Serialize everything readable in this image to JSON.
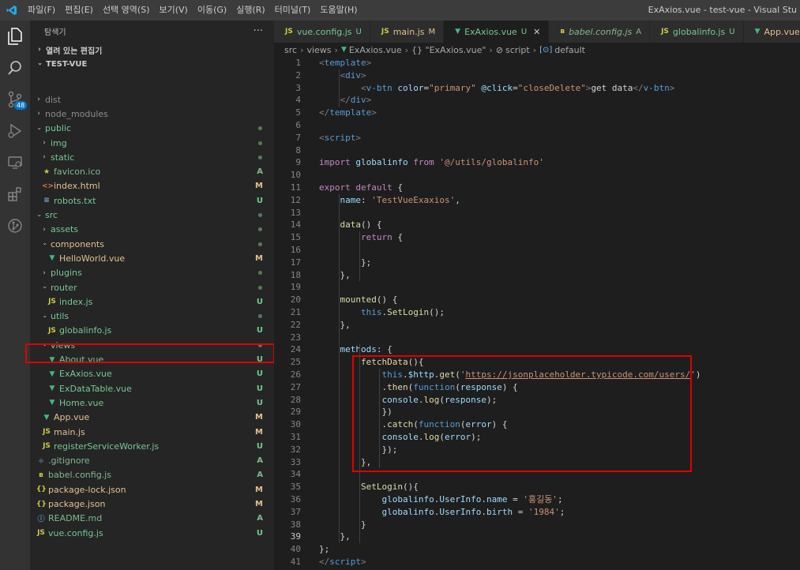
{
  "app": {
    "menu": [
      "파일(F)",
      "편집(E)",
      "선택 영역(S)",
      "보기(V)",
      "이동(G)",
      "실행(R)",
      "터미널(T)",
      "도움말(H)"
    ],
    "window_title": "ExAxios.vue - test-vue - Visual Stu"
  },
  "activity": {
    "scm_badge": "48"
  },
  "explorer": {
    "header": "탐색기",
    "more": "···",
    "open_editors": "열려 있는 편집기",
    "project": "TEST-VUE",
    "items": [
      {
        "label": "dist",
        "depth": 1,
        "kind": "folder",
        "status": "",
        "color": "#8c8c8c"
      },
      {
        "label": "node_modules",
        "depth": 1,
        "kind": "folder",
        "status": "",
        "color": "#8c8c8c"
      },
      {
        "label": "public",
        "depth": 1,
        "kind": "folder-open",
        "status": "dot",
        "color": "#73c991"
      },
      {
        "label": "img",
        "depth": 2,
        "kind": "folder",
        "status": "dot",
        "color": "#73c991"
      },
      {
        "label": "static",
        "depth": 2,
        "kind": "folder",
        "status": "dot",
        "color": "#73c991"
      },
      {
        "label": "favicon.ico",
        "depth": 2,
        "kind": "star",
        "status": "A",
        "color": "#81b88b"
      },
      {
        "label": "index.html",
        "depth": 2,
        "kind": "html",
        "status": "M",
        "color": "#e2c08d"
      },
      {
        "label": "robots.txt",
        "depth": 2,
        "kind": "txt",
        "status": "U",
        "color": "#73c991"
      },
      {
        "label": "src",
        "depth": 1,
        "kind": "folder-open",
        "status": "dot",
        "color": "#73c991"
      },
      {
        "label": "assets",
        "depth": 2,
        "kind": "folder",
        "status": "dot",
        "color": "#73c991"
      },
      {
        "label": "components",
        "depth": 2,
        "kind": "folder-open",
        "status": "dot",
        "color": "#e2c08d"
      },
      {
        "label": "HelloWorld.vue",
        "depth": 3,
        "kind": "vue",
        "status": "M",
        "color": "#e2c08d"
      },
      {
        "label": "plugins",
        "depth": 2,
        "kind": "folder",
        "status": "dot",
        "color": "#73c991"
      },
      {
        "label": "router",
        "depth": 2,
        "kind": "folder-open",
        "status": "dot",
        "color": "#73c991"
      },
      {
        "label": "index.js",
        "depth": 3,
        "kind": "js",
        "status": "U",
        "color": "#73c991"
      },
      {
        "label": "utils",
        "depth": 2,
        "kind": "folder-open",
        "status": "dot",
        "color": "#73c991"
      },
      {
        "label": "globalinfo.js",
        "depth": 3,
        "kind": "js",
        "status": "U",
        "color": "#73c991"
      },
      {
        "label": "views",
        "depth": 2,
        "kind": "folder-open",
        "status": "dot",
        "color": "#73c991"
      },
      {
        "label": "About.vue",
        "depth": 3,
        "kind": "vue",
        "status": "U",
        "color": "#73c991"
      },
      {
        "label": "ExAxios.vue",
        "depth": 3,
        "kind": "vue",
        "status": "U",
        "color": "#73c991"
      },
      {
        "label": "ExDataTable.vue",
        "depth": 3,
        "kind": "vue",
        "status": "U",
        "color": "#73c991"
      },
      {
        "label": "Home.vue",
        "depth": 3,
        "kind": "vue",
        "status": "U",
        "color": "#73c991"
      },
      {
        "label": "App.vue",
        "depth": 2,
        "kind": "vue",
        "status": "M",
        "color": "#e2c08d"
      },
      {
        "label": "main.js",
        "depth": 2,
        "kind": "js",
        "status": "M",
        "color": "#e2c08d"
      },
      {
        "label": "registerServiceWorker.js",
        "depth": 2,
        "kind": "js",
        "status": "U",
        "color": "#73c991"
      },
      {
        "label": ".gitignore",
        "depth": 1,
        "kind": "git",
        "status": "A",
        "color": "#81b88b"
      },
      {
        "label": "babel.config.js",
        "depth": 1,
        "kind": "babel",
        "status": "A",
        "color": "#81b88b"
      },
      {
        "label": "package-lock.json",
        "depth": 1,
        "kind": "json",
        "status": "M",
        "color": "#e2c08d"
      },
      {
        "label": "package.json",
        "depth": 1,
        "kind": "json",
        "status": "M",
        "color": "#e2c08d"
      },
      {
        "label": "README.md",
        "depth": 1,
        "kind": "info",
        "status": "A",
        "color": "#81b88b"
      },
      {
        "label": "vue.config.js",
        "depth": 1,
        "kind": "js",
        "status": "U",
        "color": "#73c991"
      }
    ]
  },
  "tabs": [
    {
      "label": "vue.config.js",
      "status": "U",
      "kind": "js",
      "active": false,
      "color": "#73c991"
    },
    {
      "label": "main.js",
      "status": "M",
      "kind": "js",
      "active": false,
      "color": "#e2c08d"
    },
    {
      "label": "ExAxios.vue",
      "status": "U",
      "kind": "vue",
      "active": true,
      "color": "#73c991"
    },
    {
      "label": "babel.config.js",
      "status": "A",
      "kind": "babel",
      "active": false,
      "color": "#81b88b",
      "italic": true
    },
    {
      "label": "globalinfo.js",
      "status": "U",
      "kind": "js",
      "active": false,
      "color": "#73c991"
    },
    {
      "label": "App.vue",
      "status": "M",
      "kind": "vue",
      "active": false,
      "color": "#e2c08d"
    }
  ],
  "breadcrumb": [
    "src",
    "views",
    "ExAxios.vue",
    "{} \"ExAxios.vue\"",
    "script",
    "default"
  ],
  "editor": {
    "current_line": 39,
    "lines": [
      [
        [
          "c-br",
          "<"
        ],
        [
          "c-tag",
          "template"
        ],
        [
          "c-br",
          ">"
        ]
      ],
      [
        [
          "c-txt",
          "    "
        ],
        [
          "c-br",
          "<"
        ],
        [
          "c-tag",
          "div"
        ],
        [
          "c-br",
          ">"
        ]
      ],
      [
        [
          "c-txt",
          "        "
        ],
        [
          "c-br",
          "<"
        ],
        [
          "c-tag",
          "v-btn"
        ],
        [
          "c-txt",
          " "
        ],
        [
          "c-attr",
          "color"
        ],
        [
          "c-txt",
          "="
        ],
        [
          "c-str",
          "\"primary\""
        ],
        [
          "c-txt",
          " "
        ],
        [
          "c-attr",
          "@click"
        ],
        [
          "c-txt",
          "="
        ],
        [
          "c-str",
          "\"closeDelete\""
        ],
        [
          "c-br",
          ">"
        ],
        [
          "c-txt",
          "get data"
        ],
        [
          "c-br",
          "</"
        ],
        [
          "c-tag",
          "v-btn"
        ],
        [
          "c-br",
          ">"
        ]
      ],
      [
        [
          "c-txt",
          "    "
        ],
        [
          "c-br",
          "</"
        ],
        [
          "c-tag",
          "div"
        ],
        [
          "c-br",
          ">"
        ]
      ],
      [
        [
          "c-br",
          "</"
        ],
        [
          "c-tag",
          "template"
        ],
        [
          "c-br",
          ">"
        ]
      ],
      [],
      [
        [
          "c-br",
          "<"
        ],
        [
          "c-tag",
          "script"
        ],
        [
          "c-br",
          ">"
        ]
      ],
      [],
      [
        [
          "c-kw",
          "import"
        ],
        [
          "c-txt",
          " "
        ],
        [
          "c-var",
          "globalinfo"
        ],
        [
          "c-txt",
          " "
        ],
        [
          "c-kw",
          "from"
        ],
        [
          "c-txt",
          " "
        ],
        [
          "c-str",
          "'@/utils/globalinfo'"
        ]
      ],
      [],
      [
        [
          "c-kw",
          "export"
        ],
        [
          "c-txt",
          " "
        ],
        [
          "c-kw",
          "default"
        ],
        [
          "c-txt",
          " {"
        ]
      ],
      [
        [
          "c-txt",
          "    "
        ],
        [
          "c-var",
          "name"
        ],
        [
          "c-txt",
          ": "
        ],
        [
          "c-str",
          "'TestVueExaxios'"
        ],
        [
          "c-txt",
          ","
        ]
      ],
      [],
      [
        [
          "c-txt",
          "    "
        ],
        [
          "c-fn",
          "data"
        ],
        [
          "c-txt",
          "() {"
        ]
      ],
      [
        [
          "c-txt",
          "        "
        ],
        [
          "c-kw",
          "return"
        ],
        [
          "c-txt",
          " {"
        ]
      ],
      [],
      [
        [
          "c-txt",
          "        };"
        ]
      ],
      [
        [
          "c-txt",
          "    },"
        ]
      ],
      [],
      [
        [
          "c-txt",
          "    "
        ],
        [
          "c-fn",
          "mounted"
        ],
        [
          "c-txt",
          "() {"
        ]
      ],
      [
        [
          "c-txt",
          "        "
        ],
        [
          "c-blue",
          "this"
        ],
        [
          "c-txt",
          "."
        ],
        [
          "c-fn",
          "SetLogin"
        ],
        [
          "c-txt",
          "();"
        ]
      ],
      [
        [
          "c-txt",
          "    },"
        ]
      ],
      [],
      [
        [
          "c-txt",
          "    "
        ],
        [
          "c-var",
          "methods"
        ],
        [
          "c-txt",
          ": {"
        ]
      ],
      [
        [
          "c-txt",
          "        "
        ],
        [
          "c-fn",
          "fetchData"
        ],
        [
          "c-txt",
          "(){"
        ]
      ],
      [
        [
          "c-txt",
          "            "
        ],
        [
          "c-blue",
          "this"
        ],
        [
          "c-txt",
          "."
        ],
        [
          "c-var",
          "$http"
        ],
        [
          "c-txt",
          "."
        ],
        [
          "c-fn",
          "get"
        ],
        [
          "c-txt",
          "("
        ],
        [
          "c-str",
          "'"
        ],
        [
          "c-url",
          "https://jsonplaceholder.typicode.com/users/"
        ],
        [
          "c-str",
          "'"
        ],
        [
          "c-txt",
          ")"
        ]
      ],
      [
        [
          "c-txt",
          "            ."
        ],
        [
          "c-fn",
          "then"
        ],
        [
          "c-txt",
          "("
        ],
        [
          "c-blue",
          "function"
        ],
        [
          "c-txt",
          "("
        ],
        [
          "c-var",
          "response"
        ],
        [
          "c-txt",
          ") {"
        ]
      ],
      [
        [
          "c-txt",
          "            "
        ],
        [
          "c-var",
          "console"
        ],
        [
          "c-txt",
          "."
        ],
        [
          "c-fn",
          "log"
        ],
        [
          "c-txt",
          "("
        ],
        [
          "c-var",
          "response"
        ],
        [
          "c-txt",
          ");"
        ]
      ],
      [
        [
          "c-txt",
          "            })"
        ]
      ],
      [
        [
          "c-txt",
          "            ."
        ],
        [
          "c-fn",
          "catch"
        ],
        [
          "c-txt",
          "("
        ],
        [
          "c-blue",
          "function"
        ],
        [
          "c-txt",
          "("
        ],
        [
          "c-var",
          "error"
        ],
        [
          "c-txt",
          ") {"
        ]
      ],
      [
        [
          "c-txt",
          "            "
        ],
        [
          "c-var",
          "console"
        ],
        [
          "c-txt",
          "."
        ],
        [
          "c-fn",
          "log"
        ],
        [
          "c-txt",
          "("
        ],
        [
          "c-var",
          "error"
        ],
        [
          "c-txt",
          ");"
        ]
      ],
      [
        [
          "c-txt",
          "            });"
        ]
      ],
      [
        [
          "c-txt",
          "        },"
        ]
      ],
      [],
      [
        [
          "c-txt",
          "        "
        ],
        [
          "c-fn",
          "SetLogin"
        ],
        [
          "c-txt",
          "(){"
        ]
      ],
      [
        [
          "c-txt",
          "            "
        ],
        [
          "c-var",
          "globalinfo"
        ],
        [
          "c-txt",
          "."
        ],
        [
          "c-var",
          "UserInfo"
        ],
        [
          "c-txt",
          "."
        ],
        [
          "c-var",
          "name"
        ],
        [
          "c-txt",
          " = "
        ],
        [
          "c-str",
          "'홍길동'"
        ],
        [
          "c-txt",
          ";"
        ]
      ],
      [
        [
          "c-txt",
          "            "
        ],
        [
          "c-var",
          "globalinfo"
        ],
        [
          "c-txt",
          "."
        ],
        [
          "c-var",
          "UserInfo"
        ],
        [
          "c-txt",
          "."
        ],
        [
          "c-var",
          "birth"
        ],
        [
          "c-txt",
          " = "
        ],
        [
          "c-str",
          "'1984'"
        ],
        [
          "c-txt",
          ";"
        ]
      ],
      [
        [
          "c-txt",
          "        }"
        ]
      ],
      [
        [
          "c-txt",
          "    },"
        ]
      ],
      [
        [
          "c-txt",
          "};"
        ]
      ],
      [
        [
          "c-br",
          "</"
        ],
        [
          "c-tag",
          "script"
        ],
        [
          "c-br",
          ">"
        ]
      ]
    ]
  }
}
